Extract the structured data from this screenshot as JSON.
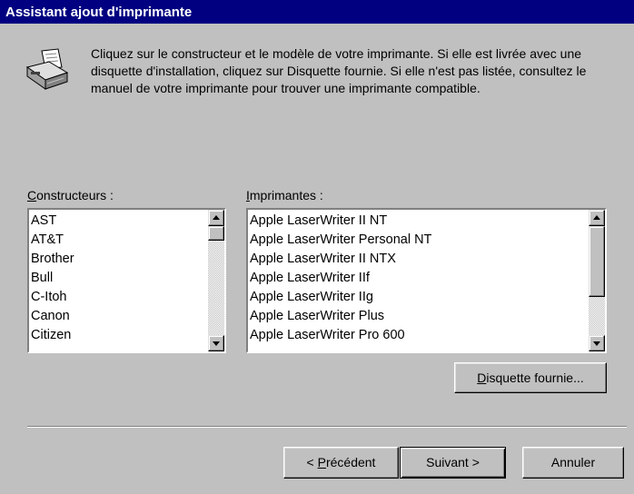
{
  "window": {
    "title": "Assistant ajout d'imprimante"
  },
  "instructions": "Cliquez sur le constructeur et le modèle de votre imprimante. Si elle est livrée avec une disquette d'installation, cliquez sur Disquette fournie. Si elle n'est pas listée, consultez le manuel de votre imprimante pour trouver une imprimante compatible.",
  "manufacturers": {
    "label_mnemonic": "C",
    "label_rest": "onstructeurs :",
    "items": [
      "AST",
      "AT&T",
      "Brother",
      "Bull",
      "C-Itoh",
      "Canon",
      "Citizen"
    ],
    "scroll_position": 0.0
  },
  "printers": {
    "label_mnemonic": "I",
    "label_rest": "mprimantes :",
    "items": [
      "Apple LaserWriter II NT",
      "Apple LaserWriter Personal NT",
      "Apple LaserWriter II NTX",
      "Apple LaserWriter IIf",
      "Apple LaserWriter IIg",
      "Apple LaserWriter Plus",
      "Apple LaserWriter Pro 600"
    ],
    "scroll_position": 0.0
  },
  "buttons": {
    "have_disk_mnemonic": "D",
    "have_disk_rest": "isquette fournie...",
    "back_prefix": "< ",
    "back_mnemonic": "P",
    "back_rest": "récédent",
    "next": "Suivant >",
    "cancel": "Annuler"
  },
  "icons": {
    "wizard": "printer-icon",
    "scroll_up": "arrow-up-icon",
    "scroll_down": "arrow-down-icon"
  }
}
